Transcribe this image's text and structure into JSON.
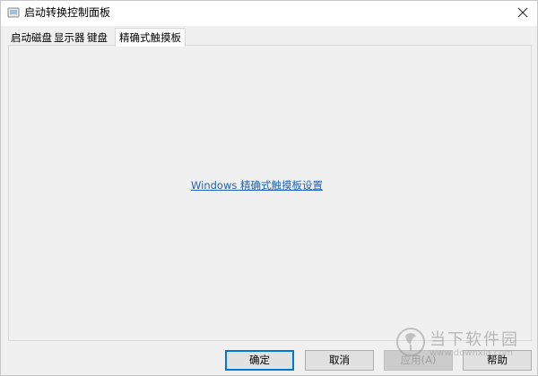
{
  "window": {
    "title": "启动转换控制面板",
    "close_symbol": "✕"
  },
  "tabs": [
    {
      "label": "启动磁盘",
      "active": false
    },
    {
      "label": "显示器",
      "active": false
    },
    {
      "label": "键盘",
      "active": false
    },
    {
      "label": "精确式触摸板",
      "active": true
    }
  ],
  "panel": {
    "link_text": "Windows 精确式触摸板设置"
  },
  "buttons": {
    "ok": "确定",
    "cancel": "取消",
    "apply": "应用(A)",
    "help": "帮助"
  },
  "watermark": {
    "text": "当下软件园",
    "url": "www.downxia.com"
  },
  "colors": {
    "link": "#1e63b8",
    "focus_border": "#0078d7",
    "window_bg": "#f0f0f0"
  },
  "icons": [
    "app-icon",
    "close-icon",
    "watermark-logo-icon"
  ]
}
